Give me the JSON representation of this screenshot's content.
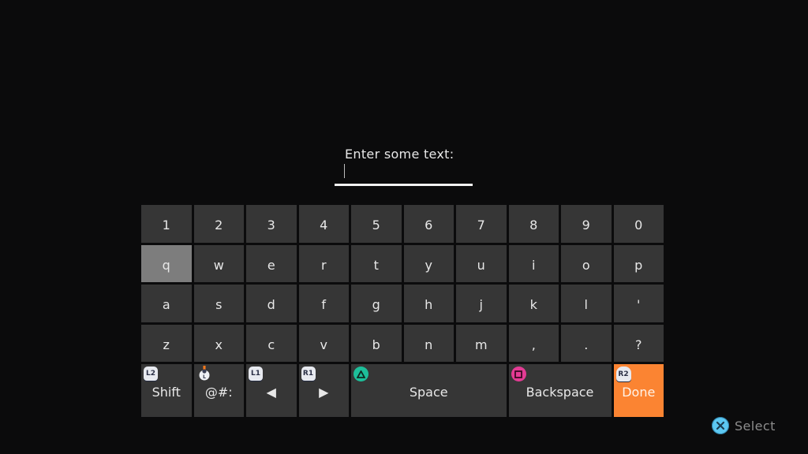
{
  "prompt": {
    "label": "Enter some text:",
    "value": ""
  },
  "keyboard": {
    "rows": [
      [
        "1",
        "2",
        "3",
        "4",
        "5",
        "6",
        "7",
        "8",
        "9",
        "0"
      ],
      [
        "q",
        "w",
        "e",
        "r",
        "t",
        "y",
        "u",
        "i",
        "o",
        "p"
      ],
      [
        "a",
        "s",
        "d",
        "f",
        "g",
        "h",
        "j",
        "k",
        "l",
        "'"
      ],
      [
        "z",
        "x",
        "c",
        "v",
        "b",
        "n",
        "m",
        ",",
        ".",
        "?"
      ]
    ],
    "selected_key": "q",
    "function_row": {
      "shift": {
        "label": "Shift",
        "button_hint": "L2"
      },
      "symbols": {
        "label": "@#:",
        "button_hint": "L-stick"
      },
      "left": {
        "label": "◀",
        "button_hint": "L1"
      },
      "right": {
        "label": "▶",
        "button_hint": "R1"
      },
      "space": {
        "label": "Space",
        "button_hint": "triangle"
      },
      "backspace": {
        "label": "Backspace",
        "button_hint": "square"
      },
      "done": {
        "label": "Done",
        "button_hint": "R2"
      }
    }
  },
  "footer": {
    "select_label": "Select",
    "select_button": "cross"
  },
  "colors": {
    "done": "#fb8432",
    "key": "#363636",
    "selected": "#7d7d7d",
    "triangle": "#1dbf9a",
    "square": "#e43b94",
    "cross": "#5cc8f2"
  }
}
